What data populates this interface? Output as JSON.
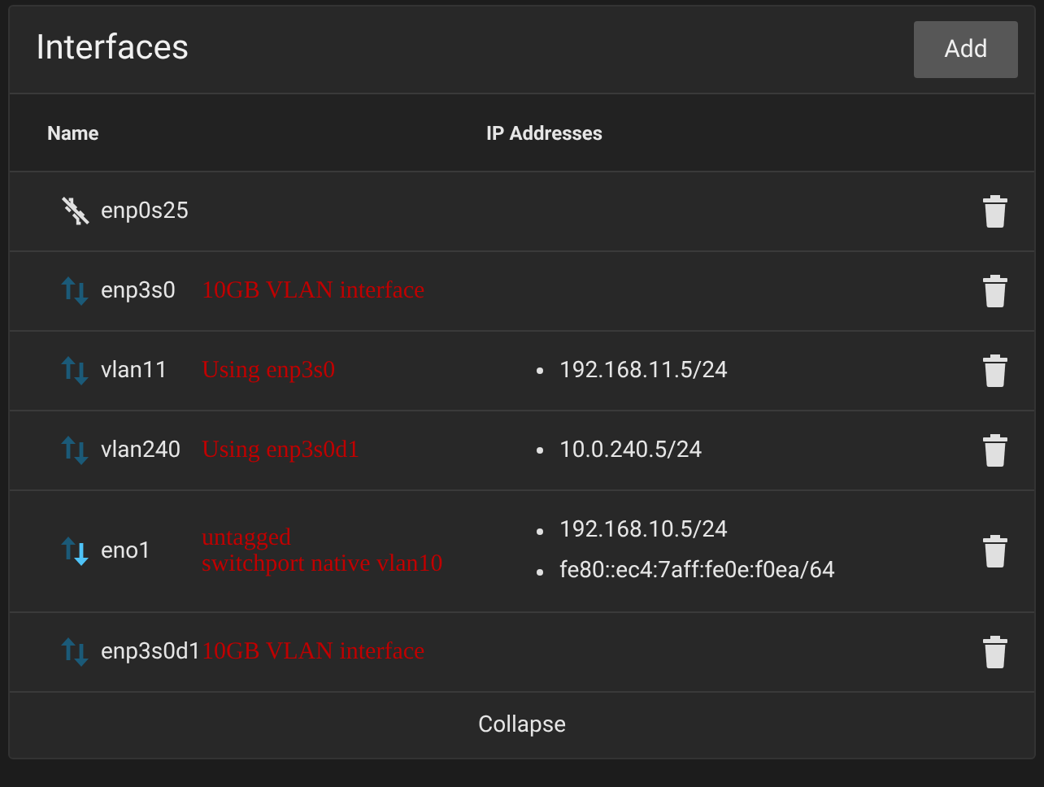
{
  "card": {
    "title": "Interfaces",
    "add_button": "Add"
  },
  "columns": [
    "Name",
    "IP Addresses"
  ],
  "rows": [
    {
      "name": "enp0s25",
      "kind": "disconnected",
      "addresses": []
    },
    {
      "name": "enp3s0",
      "kind": "idle",
      "note": "10GB VLAN interface",
      "addresses": []
    },
    {
      "name": "vlan11",
      "kind": "idle",
      "note": "Using enp3s0",
      "addresses": [
        "192.168.11.5/24"
      ]
    },
    {
      "name": "vlan240",
      "kind": "idle",
      "note": "Using enp3s0d1",
      "addresses": [
        "10.0.240.5/24"
      ]
    },
    {
      "name": "eno1",
      "kind": "receiving",
      "note": "untagged\nswitchport native vlan10",
      "addresses": [
        "192.168.10.5/24",
        "fe80::ec4:7aff:fe0e:f0ea/64"
      ]
    },
    {
      "name": "enp3s0d1",
      "kind": "idle",
      "note": "10GB VLAN interface",
      "addresses": []
    }
  ],
  "collapse_button": "Collapse"
}
